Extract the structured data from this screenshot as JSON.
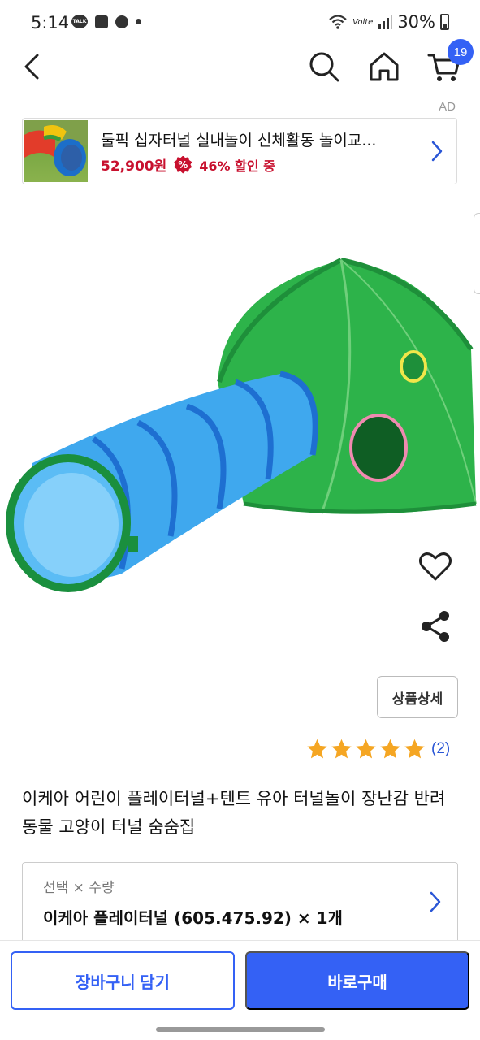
{
  "status_bar": {
    "time": "5:14",
    "talk_label": "TALK",
    "network": "Volte",
    "battery": "30%",
    "icons": [
      "kakaotalk-icon",
      "app-icon",
      "app-icon",
      "dot-icon",
      "wifi-icon",
      "signal-icon",
      "battery-icon"
    ]
  },
  "nav": {
    "icons": [
      "back-arrow-icon",
      "search-icon",
      "home-icon",
      "cart-icon"
    ],
    "cart_count": "19"
  },
  "ad": {
    "label": "AD",
    "title": "둘픽 십자터널 실내놀이 신체활동 놀이교...",
    "price": "52,900원",
    "discount_symbol": "%",
    "discount": "46% 할인 중"
  },
  "actions": {
    "icons": [
      "heart-icon",
      "share-icon"
    ],
    "detail_label": "상품상세"
  },
  "rating": {
    "stars": 5,
    "review_count": "(2)",
    "star_color": "#f5a623"
  },
  "product": {
    "title": "이케아 어린이 플레이터널+텐트 유아 터널놀이 장난감 반려동물 고양이 터널 숨숨집"
  },
  "option": {
    "label": "선택 × 수량",
    "value": "이케아 플레이터널 (605.475.92) × 1개"
  },
  "bottom": {
    "add_cart_label": "장바구니 담기",
    "buy_now_label": "바로구매"
  },
  "colors": {
    "accent": "#3461f5",
    "sale": "#c8102e"
  }
}
